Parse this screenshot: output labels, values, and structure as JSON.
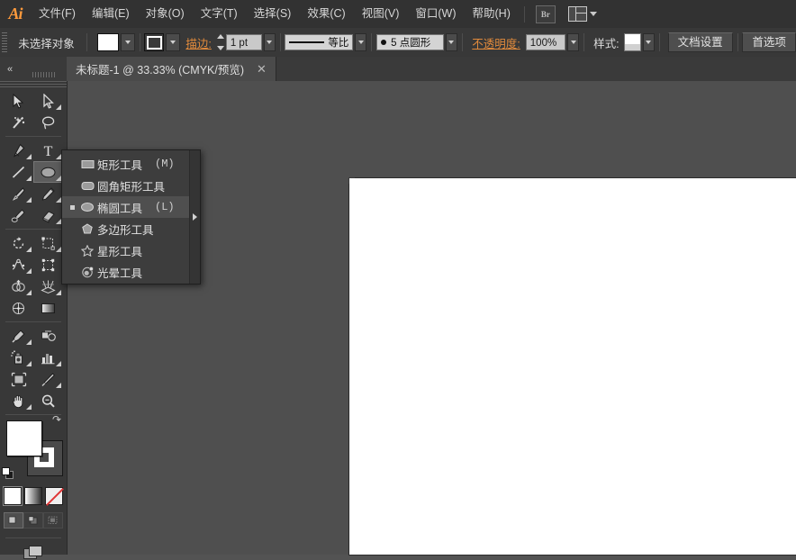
{
  "app": {
    "name": "Ai",
    "logo_color": "#ff9a3c"
  },
  "menubar": {
    "items": [
      {
        "label": "文件(F)",
        "name": "menu-file"
      },
      {
        "label": "编辑(E)",
        "name": "menu-edit"
      },
      {
        "label": "对象(O)",
        "name": "menu-object"
      },
      {
        "label": "文字(T)",
        "name": "menu-type"
      },
      {
        "label": "选择(S)",
        "name": "menu-select"
      },
      {
        "label": "效果(C)",
        "name": "menu-effect"
      },
      {
        "label": "视图(V)",
        "name": "menu-view"
      },
      {
        "label": "窗口(W)",
        "name": "menu-window"
      },
      {
        "label": "帮助(H)",
        "name": "menu-help"
      }
    ],
    "bridge_label": "Br",
    "arrange_icon": "arrange-documents-icon"
  },
  "controlbar": {
    "selection_status": "未选择对象",
    "fill_swatch": "#ffffff",
    "stroke_label": "描边:",
    "stroke_weight": "1 pt",
    "stroke_profile": "等比",
    "brush_definition": "5 点圆形",
    "opacity_label": "不透明度:",
    "opacity_value": "100%",
    "style_label": "样式:",
    "document_setup_button": "文档设置",
    "preferences_button": "首选项",
    "link_color": "#e08a3c"
  },
  "tabbar": {
    "collapse_icon": "collapse-panels-icon",
    "document_tab": {
      "title": "未标题-1 @ 33.33% (CMYK/预览)",
      "close_label": "✕"
    }
  },
  "toolbar": {
    "tools": [
      {
        "name": "selection-tool",
        "icon": "arrow-solid-icon",
        "has_flyout": false
      },
      {
        "name": "direct-selection-tool",
        "icon": "arrow-hollow-icon",
        "has_flyout": true
      },
      {
        "name": "magic-wand-tool",
        "icon": "magic-wand-icon",
        "has_flyout": false
      },
      {
        "name": "lasso-tool",
        "icon": "lasso-icon",
        "has_flyout": false
      },
      {
        "name": "pen-tool",
        "icon": "pen-icon",
        "has_flyout": true
      },
      {
        "name": "type-tool",
        "icon": "type-icon",
        "has_flyout": true
      },
      {
        "name": "line-segment-tool",
        "icon": "line-icon",
        "has_flyout": true
      },
      {
        "name": "ellipse-tool",
        "icon": "ellipse-icon",
        "has_flyout": true,
        "selected": true
      },
      {
        "name": "paintbrush-tool",
        "icon": "paintbrush-icon",
        "has_flyout": true
      },
      {
        "name": "pencil-tool",
        "icon": "pencil-icon",
        "has_flyout": true
      },
      {
        "name": "blob-brush-tool",
        "icon": "blob-brush-icon",
        "has_flyout": false
      },
      {
        "name": "eraser-tool",
        "icon": "eraser-icon",
        "has_flyout": true
      },
      {
        "name": "rotate-tool",
        "icon": "rotate-icon",
        "has_flyout": true
      },
      {
        "name": "scale-tool",
        "icon": "scale-icon",
        "has_flyout": true
      },
      {
        "name": "width-tool",
        "icon": "width-icon",
        "has_flyout": true
      },
      {
        "name": "free-transform-tool",
        "icon": "free-transform-icon",
        "has_flyout": false
      },
      {
        "name": "shape-builder-tool",
        "icon": "shape-builder-icon",
        "has_flyout": true
      },
      {
        "name": "perspective-grid-tool",
        "icon": "perspective-grid-icon",
        "has_flyout": true
      },
      {
        "name": "mesh-tool",
        "icon": "mesh-icon",
        "has_flyout": false
      },
      {
        "name": "gradient-tool",
        "icon": "gradient-icon",
        "has_flyout": false
      },
      {
        "name": "eyedropper-tool",
        "icon": "eyedropper-icon",
        "has_flyout": true
      },
      {
        "name": "blend-tool",
        "icon": "blend-icon",
        "has_flyout": false
      },
      {
        "name": "symbol-sprayer-tool",
        "icon": "symbol-sprayer-icon",
        "has_flyout": true
      },
      {
        "name": "column-graph-tool",
        "icon": "bar-graph-icon",
        "has_flyout": true
      },
      {
        "name": "artboard-tool",
        "icon": "artboard-icon",
        "has_flyout": false
      },
      {
        "name": "slice-tool",
        "icon": "slice-knife-icon",
        "has_flyout": true
      },
      {
        "name": "hand-tool",
        "icon": "hand-icon",
        "has_flyout": true
      },
      {
        "name": "zoom-tool",
        "icon": "magnifier-icon",
        "has_flyout": false
      }
    ],
    "fill_stroke": {
      "fill_color": "#ffffff",
      "stroke_color": "#ffffff",
      "swap_icon": "swap-fill-stroke-icon",
      "default_icon": "default-fill-stroke-icon"
    },
    "color_modes": [
      {
        "name": "color-mode-button",
        "label": "颜色",
        "selected": true
      },
      {
        "name": "gradient-mode-button",
        "label": "渐变",
        "selected": false
      },
      {
        "name": "none-mode-button",
        "label": "无",
        "selected": false
      }
    ],
    "draw_modes": [
      {
        "name": "draw-normal-button",
        "selected": true
      },
      {
        "name": "draw-behind-button",
        "selected": false
      },
      {
        "name": "draw-inside-button",
        "selected": false
      }
    ],
    "screen_mode": {
      "name": "change-screen-mode-button"
    }
  },
  "flyout": {
    "title": "shape-tools-flyout",
    "items": [
      {
        "label": "矩形工具",
        "shortcut": "(M)",
        "icon": "rectangle-icon",
        "active": false,
        "name": "flyout-rectangle-tool"
      },
      {
        "label": "圆角矩形工具",
        "shortcut": "",
        "icon": "rounded-rectangle-icon",
        "active": false,
        "name": "flyout-rounded-rectangle-tool"
      },
      {
        "label": "椭圆工具",
        "shortcut": "(L)",
        "icon": "ellipse-icon",
        "active": true,
        "name": "flyout-ellipse-tool"
      },
      {
        "label": "多边形工具",
        "shortcut": "",
        "icon": "polygon-icon",
        "active": false,
        "name": "flyout-polygon-tool"
      },
      {
        "label": "星形工具",
        "shortcut": "",
        "icon": "star-icon",
        "active": false,
        "name": "flyout-star-tool"
      },
      {
        "label": "光晕工具",
        "shortcut": "",
        "icon": "flare-icon",
        "active": false,
        "name": "flyout-flare-tool"
      }
    ],
    "tearoff_icon": "tear-off-arrow-icon"
  },
  "canvas": {
    "background_color": "#4f4f4f",
    "artboard_color": "#ffffff"
  }
}
